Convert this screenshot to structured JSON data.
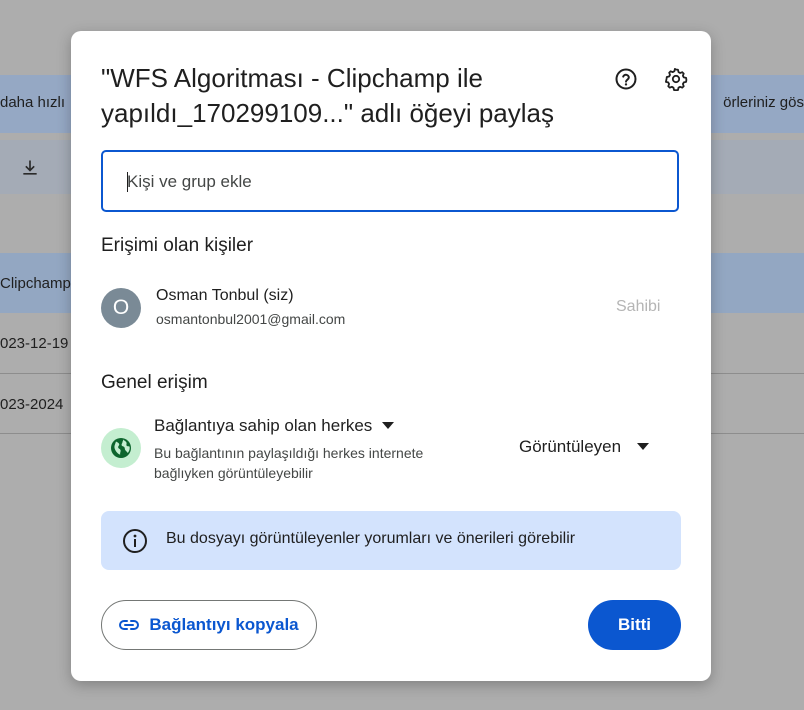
{
  "background": {
    "banner_left": "daha hızlı",
    "banner_right": "örleriniz gös",
    "row_selected": "Clipchamp",
    "row_2": "023-12-19",
    "row_3": "023-2024"
  },
  "dialog": {
    "title": "\"WFS Algoritması - Clipchamp ile yapıldı_170299109...\" adlı öğeyi paylaş",
    "help_icon": "help-circle-icon",
    "settings_icon": "gear-icon",
    "add_people": {
      "placeholder": "Kişi ve grup ekle",
      "value": ""
    },
    "people_section": {
      "heading": "Erişimi olan kişiler",
      "people": [
        {
          "initial": "O",
          "avatar_color": "#7a8a96",
          "name": "Osman Tonbul (siz)",
          "email": "osmantonbul2001@gmail.com",
          "role": "Sahibi"
        }
      ]
    },
    "general_access": {
      "heading": "Genel erişim",
      "scope_label": "Bağlantıya sahip olan herkes",
      "description": "Bu bağlantının paylaşıldığı herkes internete bağlıyken görüntüleyebilir",
      "role_label": "Görüntüleyen",
      "icon": "globe-icon",
      "icon_bg": "#c4eed0"
    },
    "info": {
      "text": "Bu dosyayı görüntüleyenler yorumları ve önerileri görebilir",
      "bg": "#d3e3fd"
    },
    "footer": {
      "copy_link_label": "Bağlantıyı kopyala",
      "done_label": "Bitti",
      "accent": "#0b57d0"
    }
  }
}
